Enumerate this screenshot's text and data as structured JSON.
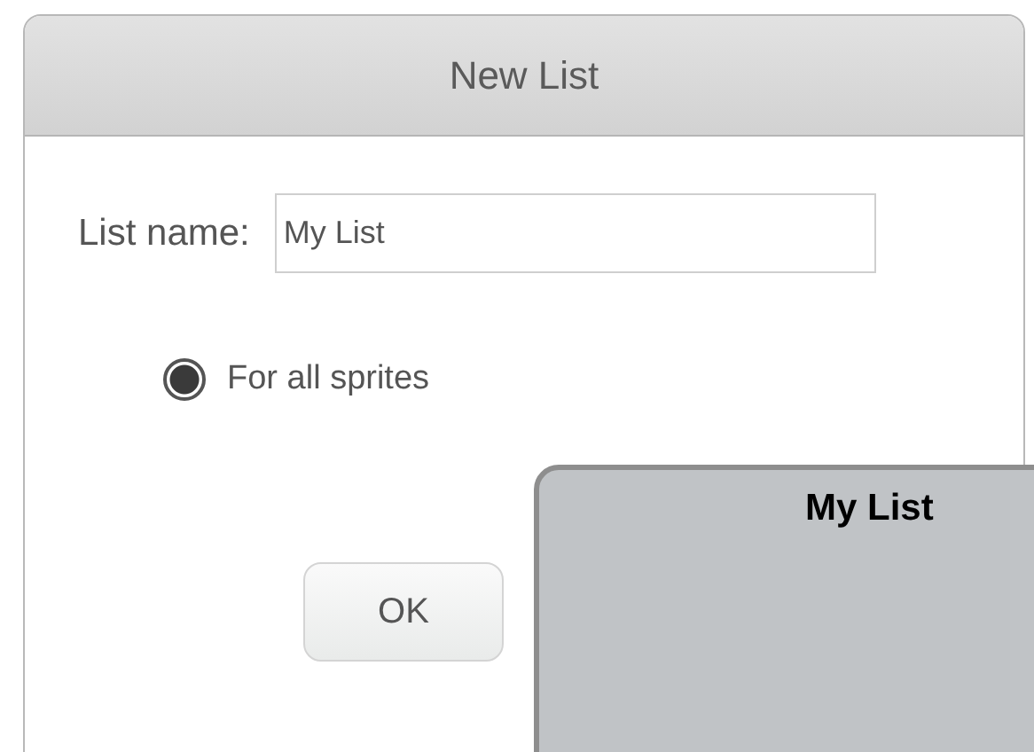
{
  "dialog": {
    "title": "New List",
    "name_label": "List name:",
    "name_value": "My List",
    "options": [
      {
        "label": "For all sprites",
        "selected": true
      }
    ],
    "buttons": [
      "OK"
    ]
  },
  "list_monitor": {
    "title": "My List"
  }
}
